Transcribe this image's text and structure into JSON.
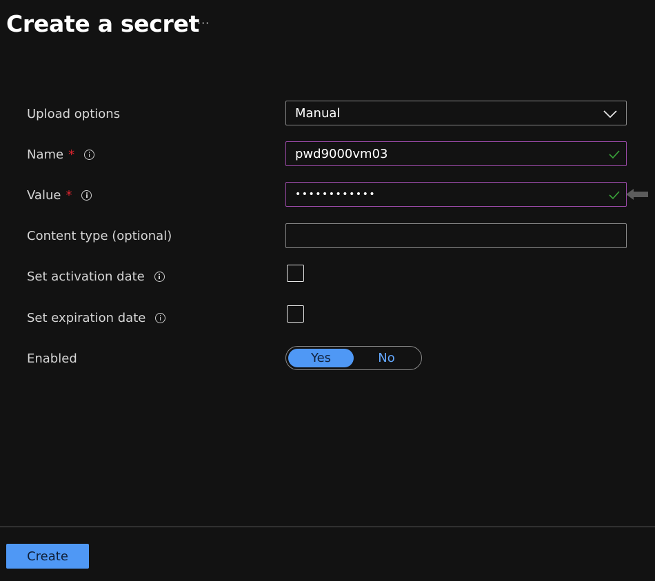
{
  "header": {
    "title": "Create a secret",
    "more_label": "···"
  },
  "form": {
    "upload_options": {
      "label": "Upload options",
      "value": "Manual"
    },
    "name": {
      "label": "Name",
      "required_mark": "*",
      "value": "pwd9000vm03"
    },
    "value": {
      "label": "Value",
      "required_mark": "*",
      "value": "••••••••••••"
    },
    "content_type": {
      "label": "Content type (optional)",
      "value": ""
    },
    "activation_date": {
      "label": "Set activation date",
      "checked": false
    },
    "expiration_date": {
      "label": "Set expiration date",
      "checked": false
    },
    "enabled": {
      "label": "Enabled",
      "options": [
        "Yes",
        "No"
      ],
      "selected": "Yes"
    }
  },
  "footer": {
    "create_label": "Create"
  },
  "colors": {
    "background": "#121212",
    "accent": "#4f98f5",
    "valid_border": "#9b4aa8",
    "check": "#3aa53a",
    "required": "#e0242f"
  }
}
